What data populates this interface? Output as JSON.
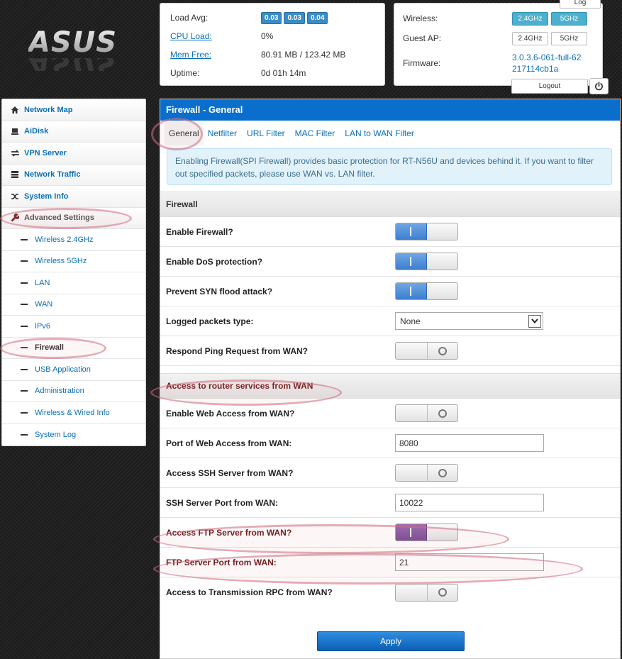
{
  "brand": {
    "logo_text": "ASUS"
  },
  "status": {
    "load_avg_label": "Load Avg:",
    "load_avg": [
      "0.03",
      "0.03",
      "0.04"
    ],
    "cpu_label": "CPU Load:",
    "cpu_value": "0%",
    "mem_label": "Mem Free:",
    "mem_value": "80.91 MB / 123.42 MB",
    "uptime_label": "Uptime:",
    "uptime_value": "0d 01h 14m"
  },
  "wifi": {
    "wireless_label": "Wireless:",
    "guest_label": "Guest AP:",
    "band_24": "2.4GHz",
    "band_5": "5GHz",
    "firmware_label": "Firmware:",
    "firmware_value": "3.0.3.6-061-full-62217114cb1a",
    "log_label": "Log",
    "logout_label": "Logout"
  },
  "sidebar": {
    "items": [
      {
        "label": "Network Map",
        "icon": "home-icon"
      },
      {
        "label": "AiDisk",
        "icon": "disk-icon"
      },
      {
        "label": "VPN Server",
        "icon": "vpn-icon"
      },
      {
        "label": "Network Traffic",
        "icon": "traffic-icon"
      },
      {
        "label": "System Info",
        "icon": "shuffle-icon"
      },
      {
        "label": "Advanced Settings",
        "icon": "wrench-icon"
      }
    ],
    "sub": [
      "Wireless 2.4GHz",
      "Wireless 5GHz",
      "LAN",
      "WAN",
      "IPv6",
      "Firewall",
      "USB Application",
      "Administration",
      "Wireless & Wired Info",
      "System Log"
    ]
  },
  "main": {
    "title": "Firewall - General",
    "tabs": [
      "General",
      "Netfilter",
      "URL Filter",
      "MAC Filter",
      "LAN to WAN Filter"
    ],
    "info": "Enabling Firewall(SPI Firewall) provides basic protection for RT-N56U and devices behind it. If you want to filter out specified packets, please use WAN vs. LAN filter.",
    "section_firewall": "Firewall",
    "enable_firewall": "Enable Firewall?",
    "enable_dos": "Enable DoS protection?",
    "prevent_syn": "Prevent SYN flood attack?",
    "logged_type": "Logged packets type:",
    "logged_value": "None",
    "respond_ping": "Respond Ping Request from WAN?",
    "section_access": "Access to router services from WAN",
    "web_access": "Enable Web Access from WAN?",
    "web_port_label": "Port of Web Access from WAN:",
    "web_port": "8080",
    "ssh_access": "Access SSH Server from WAN?",
    "ssh_port_label": "SSH Server Port from WAN:",
    "ssh_port": "10022",
    "ftp_access": "Access FTP Server from WAN?",
    "ftp_port_label": "FTP Server Port from WAN:",
    "ftp_port": "21",
    "transmission": "Access to Transmission RPC from WAN?",
    "apply_label": "Apply"
  }
}
